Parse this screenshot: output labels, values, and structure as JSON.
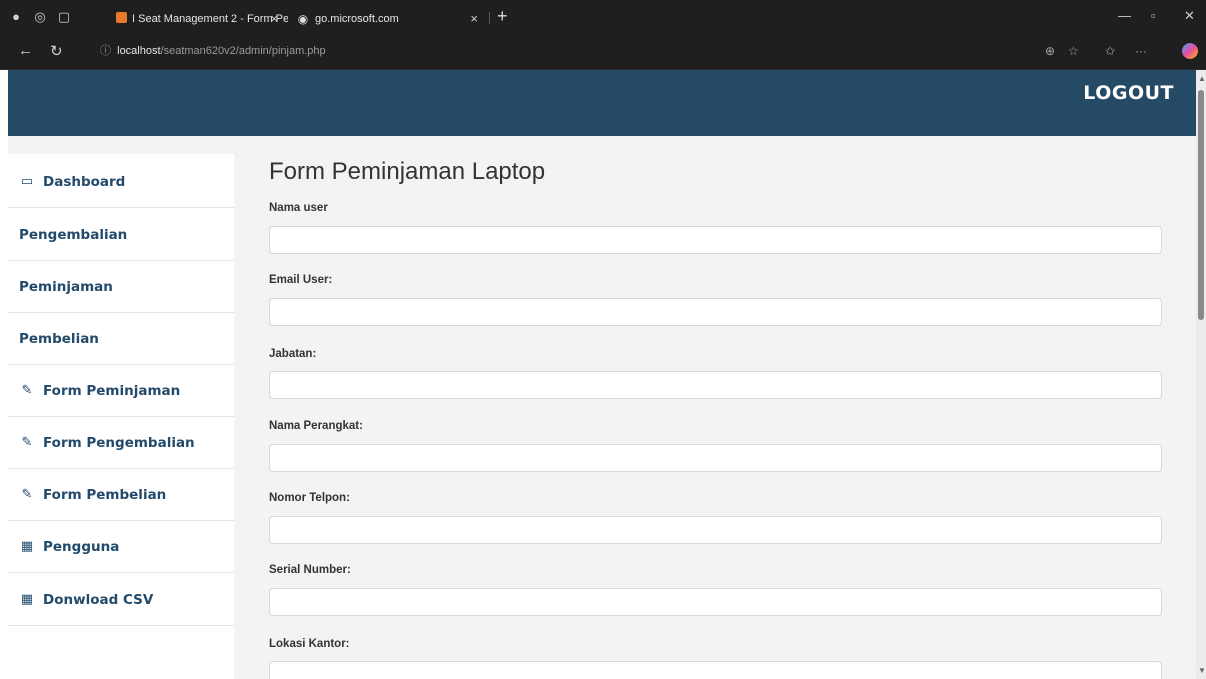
{
  "browser": {
    "tabs": [
      {
        "title": "I Seat Management 2 - Form Pen",
        "active": true
      },
      {
        "title": "go.microsoft.com",
        "active": false
      }
    ],
    "url_host": "localhost",
    "url_path": "/seatman620v2/admin/pinjam.php"
  },
  "header": {
    "logout_label": "LOGOUT",
    "color": "#244a66"
  },
  "sidebar": {
    "items": [
      {
        "label": "Dashboard",
        "icon": "monitor-icon"
      },
      {
        "label": "Pengembalian",
        "icon": ""
      },
      {
        "label": "Peminjaman",
        "icon": ""
      },
      {
        "label": "Pembelian",
        "icon": ""
      },
      {
        "label": "Form Peminjaman",
        "icon": "edit-icon"
      },
      {
        "label": "Form Pengembalian",
        "icon": "edit-icon"
      },
      {
        "label": "Form Pembelian",
        "icon": "edit-icon"
      },
      {
        "label": "Pengguna",
        "icon": "table-icon"
      },
      {
        "label": "Donwload CSV",
        "icon": "table-icon"
      }
    ]
  },
  "form": {
    "title": "Form Peminjaman Laptop",
    "fields": [
      {
        "label": "Nama user",
        "value": ""
      },
      {
        "label": "Email User:",
        "value": ""
      },
      {
        "label": "Jabatan:",
        "value": ""
      },
      {
        "label": "Nama Perangkat:",
        "value": ""
      },
      {
        "label": "Nomor Telpon:",
        "value": ""
      },
      {
        "label": "Serial Number:",
        "value": ""
      },
      {
        "label": "Lokasi Kantor:",
        "value": ""
      }
    ]
  }
}
